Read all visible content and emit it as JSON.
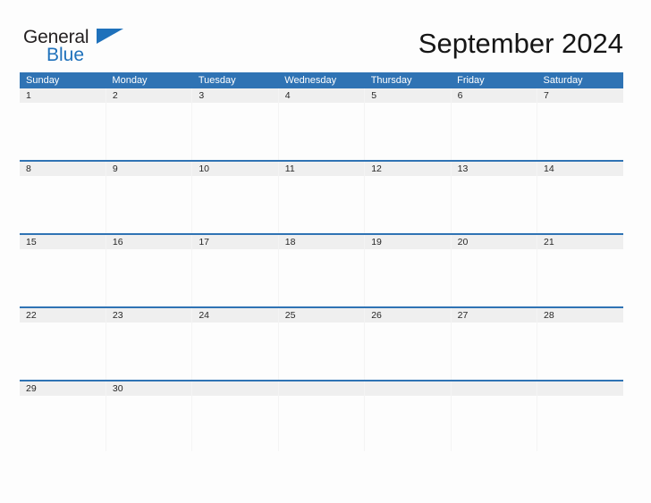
{
  "brand": {
    "name_part1": "General",
    "name_part2": "Blue",
    "flag_icon": "blue-triangle-flag-icon",
    "color_dark": "#231f20",
    "color_blue": "#1f71bb"
  },
  "header": {
    "title": "September 2024",
    "month": "September",
    "year": "2024"
  },
  "theme": {
    "header_blue": "#2f73b4",
    "date_strip_gray": "#efefef",
    "page_background": "#fdfdfd",
    "text_dark": "#262626"
  },
  "calendar": {
    "weekday_headers": [
      "Sunday",
      "Monday",
      "Tuesday",
      "Wednesday",
      "Thursday",
      "Friday",
      "Saturday"
    ],
    "weeks": [
      {
        "dates": [
          "1",
          "2",
          "3",
          "4",
          "5",
          "6",
          "7"
        ]
      },
      {
        "dates": [
          "8",
          "9",
          "10",
          "11",
          "12",
          "13",
          "14"
        ]
      },
      {
        "dates": [
          "15",
          "16",
          "17",
          "18",
          "19",
          "20",
          "21"
        ]
      },
      {
        "dates": [
          "22",
          "23",
          "24",
          "25",
          "26",
          "27",
          "28"
        ]
      },
      {
        "dates": [
          "29",
          "30",
          "",
          "",
          "",
          "",
          ""
        ]
      }
    ],
    "notes": [
      "",
      "",
      "",
      "",
      "",
      "",
      ""
    ]
  }
}
